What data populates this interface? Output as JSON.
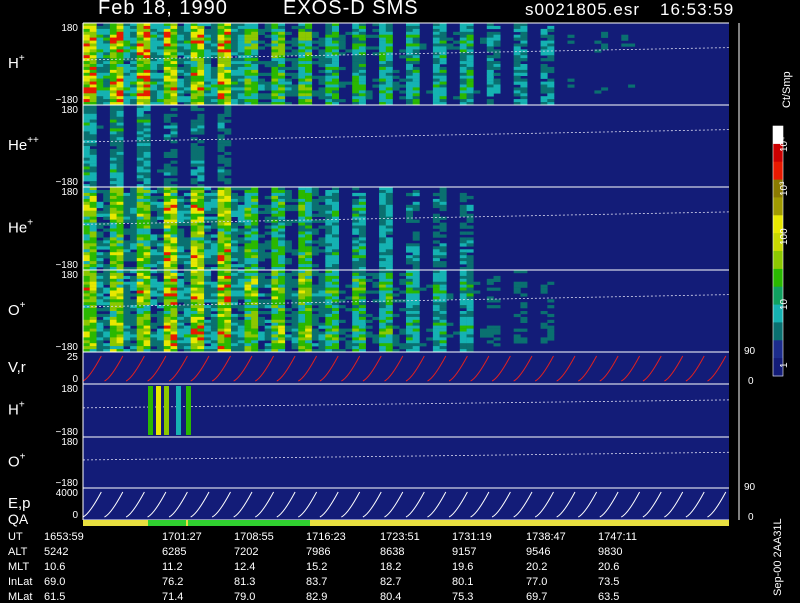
{
  "header": {
    "date": "Feb 18, 1990",
    "instrument": "EXOS-D SMS",
    "file": "s0021805.esr",
    "time": "16:53:59"
  },
  "colorbar": {
    "unit_label": "Ct/Smp",
    "ticks": [
      "10⁴",
      "10³",
      "100",
      "10",
      "1"
    ],
    "colors": [
      "#ffffff",
      "#cc0000",
      "#e81a00",
      "#8a7a00",
      "#a09a00",
      "#e8e800",
      "#c8d800",
      "#8cc800",
      "#2ab800",
      "#10a060",
      "#15b2b2",
      "#0a7070",
      "#1c2c8c",
      "#131c78"
    ]
  },
  "panels": [
    {
      "id": "h-plus",
      "label": "H",
      "sup": "+",
      "ymax": "180",
      "ymin": "−180"
    },
    {
      "id": "he-plusplus",
      "label": "He",
      "sup": "++",
      "ymax": "180",
      "ymin": "−180"
    },
    {
      "id": "he-plus",
      "label": "He",
      "sup": "+",
      "ymax": "180",
      "ymin": "−180"
    },
    {
      "id": "o-plus",
      "label": "O",
      "sup": "+",
      "ymax": "180",
      "ymin": "−180"
    },
    {
      "id": "vr",
      "label": "V,r",
      "sup": "",
      "ymax": "25",
      "ymin": "0",
      "rmax": "90",
      "rmin": "0"
    },
    {
      "id": "h-plus-2",
      "label": "H",
      "sup": "+",
      "ymax": "180",
      "ymin": "−180"
    },
    {
      "id": "o-plus-2",
      "label": "O",
      "sup": "+",
      "ymax": "180",
      "ymin": "−180"
    },
    {
      "id": "ep",
      "label": "E,p",
      "sup": "",
      "ymax": "4000",
      "ymin": "0",
      "rmax": "90",
      "rmin": "0"
    }
  ],
  "qa_label": "QA",
  "qa_colors": {
    "good": "#e8e040",
    "flag": "#30d030"
  },
  "ephemeris": {
    "rows": [
      {
        "label": "UT",
        "values": [
          "1653:59",
          "1701:27",
          "1708:55",
          "1716:23",
          "1723:51",
          "1731:19",
          "1738:47",
          "1747:11"
        ]
      },
      {
        "label": "ALT",
        "values": [
          "5242",
          "6285",
          "7202",
          "7986",
          "8638",
          "9157",
          "9546",
          "9830"
        ]
      },
      {
        "label": "MLT",
        "values": [
          "10.6",
          "11.2",
          "12.4",
          "15.2",
          "18.2",
          "19.6",
          "20.2",
          "20.6"
        ]
      },
      {
        "label": "InLat",
        "values": [
          "69.0",
          "76.2",
          "81.3",
          "83.7",
          "82.7",
          "80.1",
          "77.0",
          "73.5"
        ]
      },
      {
        "label": "MLat",
        "values": [
          "61.5",
          "71.4",
          "79.0",
          "82.9",
          "80.4",
          "75.3",
          "69.7",
          "63.5"
        ]
      }
    ]
  },
  "footer_stamp": "Sep-00  2AA31L",
  "chart_data": {
    "type": "heatmap",
    "title": "Feb 18, 1990   EXOS-D SMS",
    "x_ticks_ut": [
      "1653:59",
      "1701:27",
      "1708:55",
      "1716:23",
      "1723:51",
      "1731:19",
      "1738:47",
      "1747:11"
    ],
    "y_range_pitch": [
      -180,
      180
    ],
    "colorbar_range": [
      1,
      10000
    ],
    "colorbar_scale": "log",
    "series": [
      {
        "name": "H⁺",
        "activity": [
          0.95,
          0.85,
          0.6,
          0.5,
          0.45,
          0.35,
          0.2,
          0.1
        ]
      },
      {
        "name": "He⁺⁺",
        "activity": [
          0.4,
          0.3,
          0.1,
          0.05,
          0.03,
          0.02,
          0.01,
          0.0
        ]
      },
      {
        "name": "He⁺",
        "activity": [
          0.7,
          0.8,
          0.55,
          0.4,
          0.3,
          0.15,
          0.05,
          0.02
        ]
      },
      {
        "name": "O⁺",
        "activity": [
          0.75,
          0.85,
          0.7,
          0.55,
          0.45,
          0.25,
          0.08,
          0.03
        ]
      }
    ],
    "vr_range": [
      0,
      25
    ],
    "ep_range": [
      0,
      4000
    ]
  }
}
